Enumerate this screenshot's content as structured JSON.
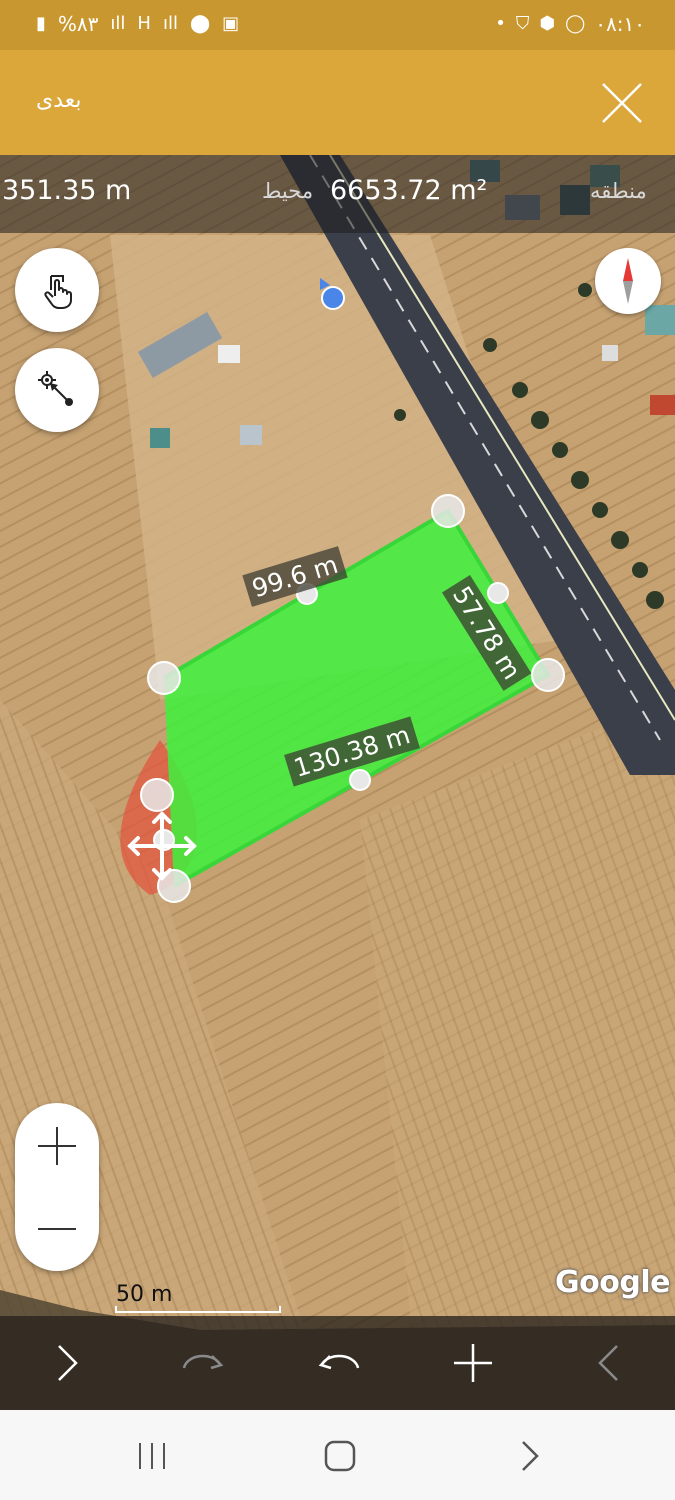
{
  "status_bar": {
    "time": "۰۸:۱۰",
    "battery": "%۸۳",
    "signal_label": "H"
  },
  "app_bar": {
    "next_label": "بعدی"
  },
  "measurements": {
    "perimeter_value": "351.35 m",
    "perimeter_label": "محیط",
    "area_value": "6653.72 m²",
    "area_label": "منطقه"
  },
  "edges": {
    "top": "99.6 m",
    "right": "57.78 m",
    "bottom": "130.38 m"
  },
  "map": {
    "scale_label": "50 m",
    "attribution": "Google",
    "polygon_color": "#3df23d"
  },
  "icons": {
    "close": "close-icon",
    "touch_mode": "hand-pointer-icon",
    "gps_point": "gps-point-icon",
    "compass": "compass-icon",
    "zoom_in": "plus-icon",
    "zoom_out": "minus-icon",
    "forward": "chevron-right-icon",
    "redo": "redo-icon",
    "undo": "undo-icon",
    "add_point": "plus-icon",
    "back": "chevron-left-icon"
  }
}
